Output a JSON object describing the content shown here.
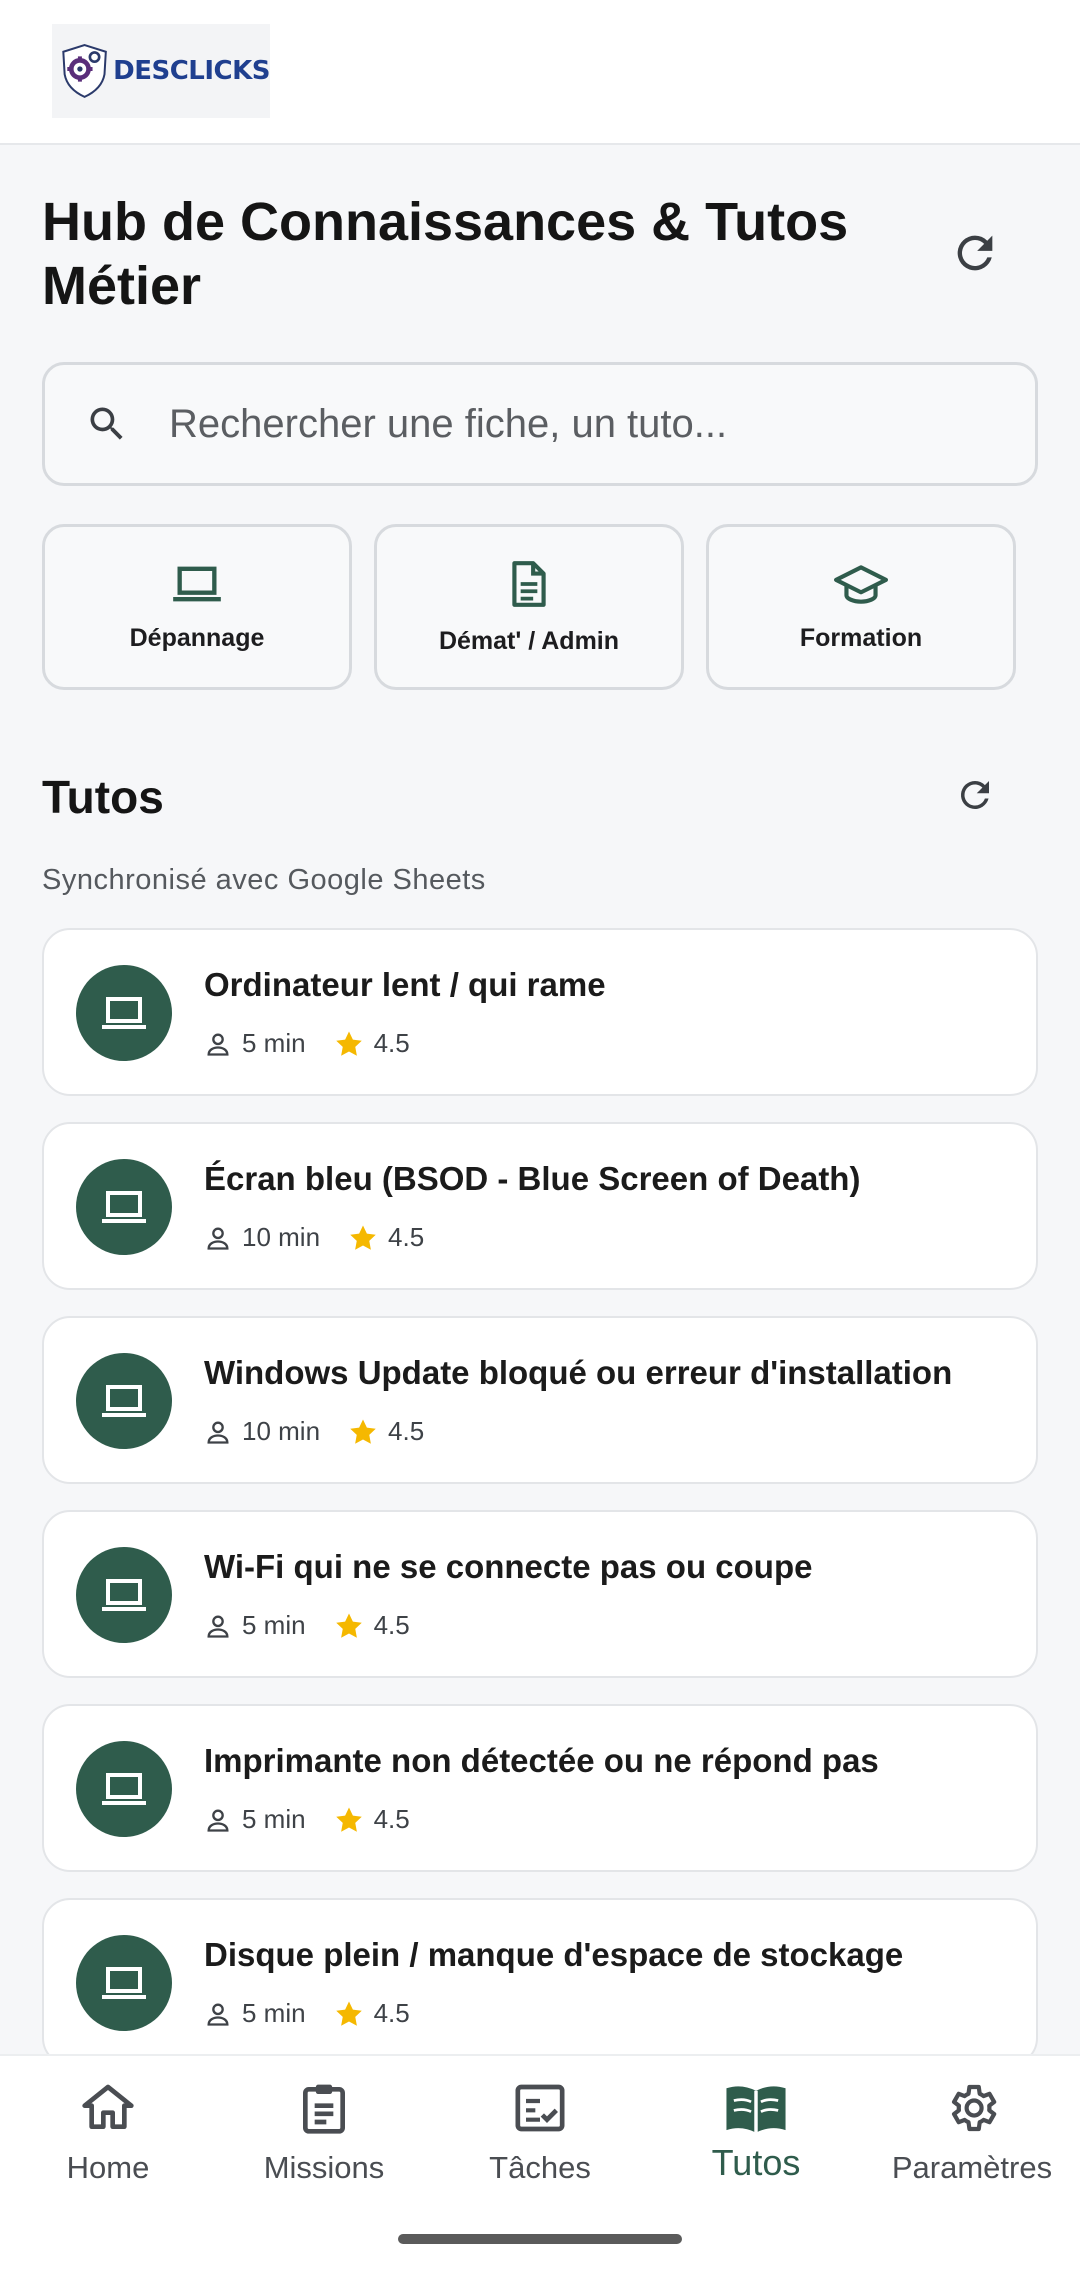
{
  "header": {
    "logo_text": "DESCLICKS"
  },
  "page": {
    "title": "Hub de Connaissances & Tutos Métier"
  },
  "search": {
    "placeholder": "Rechercher une fiche, un tuto..."
  },
  "categories": [
    {
      "label": "Dépannage",
      "icon": "laptop-icon"
    },
    {
      "label": "Démat' / Admin",
      "icon": "document-icon"
    },
    {
      "label": "Formation",
      "icon": "graduation-cap-icon"
    }
  ],
  "tutos": {
    "title": "Tutos",
    "sync_text": "Synchronisé avec Google Sheets",
    "items": [
      {
        "title": "Ordinateur lent / qui rame",
        "duration": "5 min",
        "rating": "4.5"
      },
      {
        "title": "Écran bleu (BSOD - Blue Screen of Death)",
        "duration": "10 min",
        "rating": "4.5"
      },
      {
        "title": "Windows Update bloqué ou erreur d'installation",
        "duration": "10 min",
        "rating": "4.5"
      },
      {
        "title": "Wi-Fi qui ne se connecte pas ou coupe",
        "duration": "5 min",
        "rating": "4.5"
      },
      {
        "title": "Imprimante non détectée ou ne répond pas",
        "duration": "5 min",
        "rating": "4.5"
      },
      {
        "title": "Disque plein / manque d'espace de stockage",
        "duration": "5 min",
        "rating": "4.5"
      }
    ]
  },
  "nav": {
    "items": [
      {
        "label": "Home",
        "icon": "home-icon"
      },
      {
        "label": "Missions",
        "icon": "clipboard-icon"
      },
      {
        "label": "Tâches",
        "icon": "checklist-icon"
      },
      {
        "label": "Tutos",
        "icon": "book-icon",
        "active": true
      },
      {
        "label": "Paramètres",
        "icon": "gear-icon"
      }
    ]
  },
  "colors": {
    "accent": "#2f5c4c",
    "star": "#f5b800",
    "background": "#f6f7f9"
  }
}
